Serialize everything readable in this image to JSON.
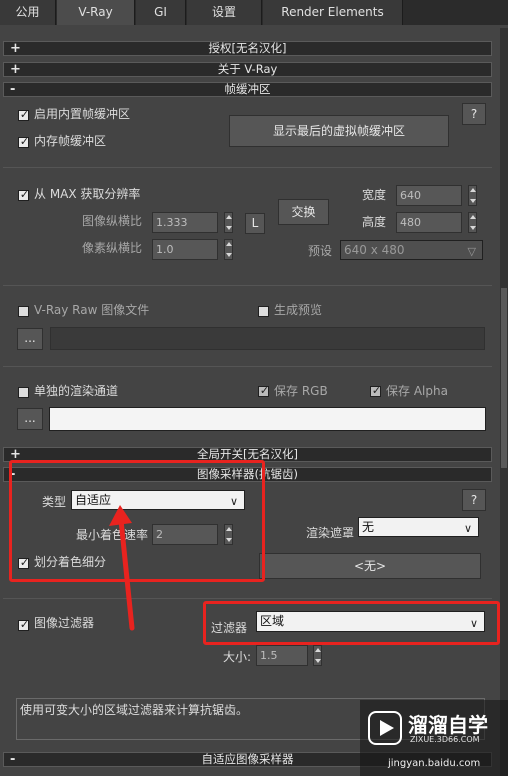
{
  "tabs": [
    "公用",
    "V-Ray",
    "GI",
    "设置",
    "Render Elements"
  ],
  "rollouts": {
    "authorization": {
      "sign": "+",
      "title": "授权[无名汉化]"
    },
    "about": {
      "sign": "+",
      "title": "关于 V-Ray"
    },
    "frame_buffer": {
      "sign": "-",
      "title": "帧缓冲区"
    },
    "global_switches": {
      "sign": "+",
      "title": "全局开关[无名汉化]"
    },
    "image_sampler": {
      "sign": "-",
      "title": "图像采样器(抗锯齿)"
    },
    "adaptive_sampler": {
      "sign": "-",
      "title": "自适应图像采样器"
    }
  },
  "frame_buffer": {
    "enable_builtin": "启用内置帧缓冲区",
    "memory_fb": "内存帧缓冲区",
    "show_last_vfb": "显示最后的虚拟帧缓冲区",
    "help": "?",
    "get_res_from_max": "从 MAX 获取分辨率",
    "image_aspect_label": "图像纵横比",
    "image_aspect_value": "1.333",
    "l_button": "L",
    "swap_button": "交换",
    "pixel_aspect_label": "像素纵横比",
    "pixel_aspect_value": "1.0",
    "width_label": "宽度",
    "width_value": "640",
    "height_label": "高度",
    "height_value": "480",
    "preset_label": "预设",
    "preset_value": "640 x 480",
    "raw_image_file": "V-Ray Raw 图像文件",
    "generate_preview": "生成预览",
    "browse": "...",
    "separate_channels": "单独的渲染通道",
    "save_rgb": "保存 RGB",
    "save_alpha": "保存 Alpha"
  },
  "image_sampler": {
    "type_label": "类型",
    "type_value": "自适应",
    "help": "?",
    "min_shading_label": "最小着色速率",
    "min_shading_value": "2",
    "render_mask_label": "渲染遮罩",
    "render_mask_value": "无",
    "divide_shading": "划分着色细分",
    "none_button": "<无>"
  },
  "filter": {
    "image_filter": "图像过滤器",
    "filter_label": "过滤器",
    "filter_value": "区域",
    "size_label": "大小:",
    "size_value": "1.5",
    "description": "使用可变大小的区域过滤器来计算抗锯齿。"
  },
  "watermark": {
    "title": "溜溜自学",
    "sub": "ZIXUE.3D66.COM",
    "site": "jingyan.baidu.com"
  },
  "colors": {
    "annotation_red": "#e8231f",
    "panel_bg": "#444444"
  }
}
